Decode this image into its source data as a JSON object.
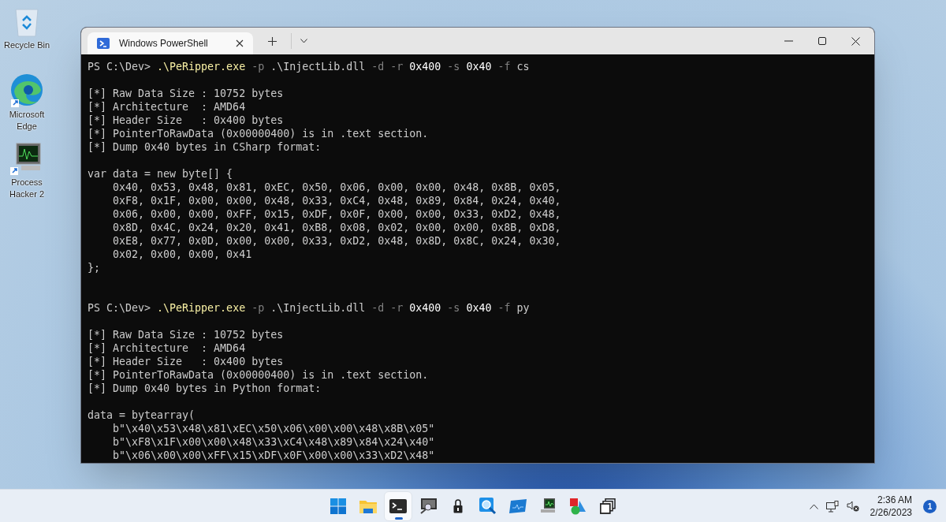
{
  "desktop_icons": [
    {
      "kind": "recycle",
      "label": "Recycle Bin"
    },
    {
      "kind": "edge",
      "label": "Microsoft Edge"
    },
    {
      "kind": "hacker",
      "label": "Process Hacker 2"
    }
  ],
  "window": {
    "tab": {
      "title": "Windows PowerShell",
      "selected": true
    }
  },
  "terminal": {
    "lines": [
      {
        "kind": "command",
        "segments": [
          {
            "kind": "text",
            "text": "PS C:\\Dev> "
          },
          {
            "kind": "exe",
            "text": ".\\PeRipper.exe"
          },
          {
            "kind": "flag",
            "text": " -p"
          },
          {
            "kind": "text",
            "text": " .\\InjectLib.dll"
          },
          {
            "kind": "flag",
            "text": " -d -r"
          },
          {
            "kind": "number",
            "text": " 0x400"
          },
          {
            "kind": "flag",
            "text": " -s"
          },
          {
            "kind": "number",
            "text": " 0x40"
          },
          {
            "kind": "flag",
            "text": " -f"
          },
          {
            "kind": "text",
            "text": " cs"
          }
        ]
      },
      {
        "kind": "blank"
      },
      {
        "kind": "output",
        "text": "[*] Raw Data Size : 10752 bytes"
      },
      {
        "kind": "output",
        "text": "[*] Architecture  : AMD64"
      },
      {
        "kind": "output",
        "text": "[*] Header Size   : 0x400 bytes"
      },
      {
        "kind": "output",
        "text": "[*] PointerToRawData (0x00000400) is in .text section."
      },
      {
        "kind": "output",
        "text": "[*] Dump 0x40 bytes in CSharp format:"
      },
      {
        "kind": "blank"
      },
      {
        "kind": "output",
        "text": "var data = new byte[] {"
      },
      {
        "kind": "output",
        "text": "    0x40, 0x53, 0x48, 0x81, 0xEC, 0x50, 0x06, 0x00, 0x00, 0x48, 0x8B, 0x05,"
      },
      {
        "kind": "output",
        "text": "    0xF8, 0x1F, 0x00, 0x00, 0x48, 0x33, 0xC4, 0x48, 0x89, 0x84, 0x24, 0x40,"
      },
      {
        "kind": "output",
        "text": "    0x06, 0x00, 0x00, 0xFF, 0x15, 0xDF, 0x0F, 0x00, 0x00, 0x33, 0xD2, 0x48,"
      },
      {
        "kind": "output",
        "text": "    0x8D, 0x4C, 0x24, 0x20, 0x41, 0xB8, 0x08, 0x02, 0x00, 0x00, 0x8B, 0xD8,"
      },
      {
        "kind": "output",
        "text": "    0xE8, 0x77, 0x0D, 0x00, 0x00, 0x33, 0xD2, 0x48, 0x8D, 0x8C, 0x24, 0x30,"
      },
      {
        "kind": "output",
        "text": "    0x02, 0x00, 0x00, 0x41"
      },
      {
        "kind": "output",
        "text": "};"
      },
      {
        "kind": "blank"
      },
      {
        "kind": "blank"
      },
      {
        "kind": "command",
        "segments": [
          {
            "kind": "text",
            "text": "PS C:\\Dev> "
          },
          {
            "kind": "exe",
            "text": ".\\PeRipper.exe"
          },
          {
            "kind": "flag",
            "text": " -p"
          },
          {
            "kind": "text",
            "text": " .\\InjectLib.dll"
          },
          {
            "kind": "flag",
            "text": " -d -r"
          },
          {
            "kind": "number",
            "text": " 0x400"
          },
          {
            "kind": "flag",
            "text": " -s"
          },
          {
            "kind": "number",
            "text": " 0x40"
          },
          {
            "kind": "flag",
            "text": " -f"
          },
          {
            "kind": "text",
            "text": " py"
          }
        ]
      },
      {
        "kind": "blank"
      },
      {
        "kind": "output",
        "text": "[*] Raw Data Size : 10752 bytes"
      },
      {
        "kind": "output",
        "text": "[*] Architecture  : AMD64"
      },
      {
        "kind": "output",
        "text": "[*] Header Size   : 0x400 bytes"
      },
      {
        "kind": "output",
        "text": "[*] PointerToRawData (0x00000400) is in .text section."
      },
      {
        "kind": "output",
        "text": "[*] Dump 0x40 bytes in Python format:"
      },
      {
        "kind": "blank"
      },
      {
        "kind": "output",
        "text": "data = bytearray("
      },
      {
        "kind": "output",
        "text": "    b\"\\x40\\x53\\x48\\x81\\xEC\\x50\\x06\\x00\\x00\\x48\\x8B\\x05\""
      },
      {
        "kind": "output",
        "text": "    b\"\\xF8\\x1F\\x00\\x00\\x48\\x33\\xC4\\x48\\x89\\x84\\x24\\x40\""
      },
      {
        "kind": "output",
        "text": "    b\"\\x06\\x00\\x00\\xFF\\x15\\xDF\\x0F\\x00\\x00\\x33\\xD2\\x48\""
      }
    ]
  },
  "taskbar": {
    "apps": [
      {
        "kind": "start",
        "active": false
      },
      {
        "kind": "folder",
        "active": false
      },
      {
        "kind": "terminal",
        "active": true
      },
      {
        "kind": "monitor-search",
        "active": false
      },
      {
        "kind": "lock",
        "active": false
      },
      {
        "kind": "magnifier",
        "active": false
      },
      {
        "kind": "chart",
        "active": false
      },
      {
        "kind": "monitor",
        "active": false
      },
      {
        "kind": "shapes",
        "active": false
      },
      {
        "kind": "windows",
        "active": false
      }
    ],
    "tray": {
      "time": "2:36 AM",
      "date": "2/26/2023",
      "notifications": "1"
    }
  }
}
